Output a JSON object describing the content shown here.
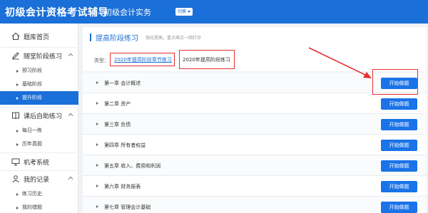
{
  "header": {
    "title": "初级会计资格考试辅导",
    "subject": "初级会计实务",
    "switch_label": "切换"
  },
  "sidebar": {
    "groups": [
      {
        "label": "题库首页",
        "icon": "home-icon"
      },
      {
        "label": "随堂阶段练习",
        "icon": "pen-icon",
        "items": [
          "预习阶段",
          "基础阶段",
          "提升阶段"
        ]
      },
      {
        "label": "课后自助练习",
        "icon": "book-icon",
        "items": [
          "每日一练",
          "历年真题"
        ]
      },
      {
        "label": "机考系统",
        "icon": "computer-icon"
      },
      {
        "label": "我的记录",
        "icon": "user-icon",
        "items": [
          "练习历史",
          "我的错题"
        ]
      }
    ],
    "active_item": "提升阶段"
  },
  "main": {
    "title": "提高阶段练习",
    "subtitle": "强化提高，重点难点一网打尽",
    "type_label": "类型：",
    "type_options": [
      "2020年提高阶段章节练习",
      "2020年提高阶段练习"
    ],
    "selected_type": "2020年提高阶段章节练习",
    "chapters": [
      {
        "label": "第一章 会计概述",
        "button": "开始做题"
      },
      {
        "label": "第二章 资产",
        "button": "开始做题"
      },
      {
        "label": "第三章 负债",
        "button": "开始做题"
      },
      {
        "label": "第四章 所有者权益",
        "button": "开始做题"
      },
      {
        "label": "第五章 收入、费用和利润",
        "button": "开始做题"
      },
      {
        "label": "第六章 财务报表",
        "button": "开始做题"
      },
      {
        "label": "第七章 管理会计基础",
        "button": "开始做题"
      }
    ]
  },
  "colors": {
    "brand": "#1a6fd8",
    "highlight": "#e53030"
  }
}
